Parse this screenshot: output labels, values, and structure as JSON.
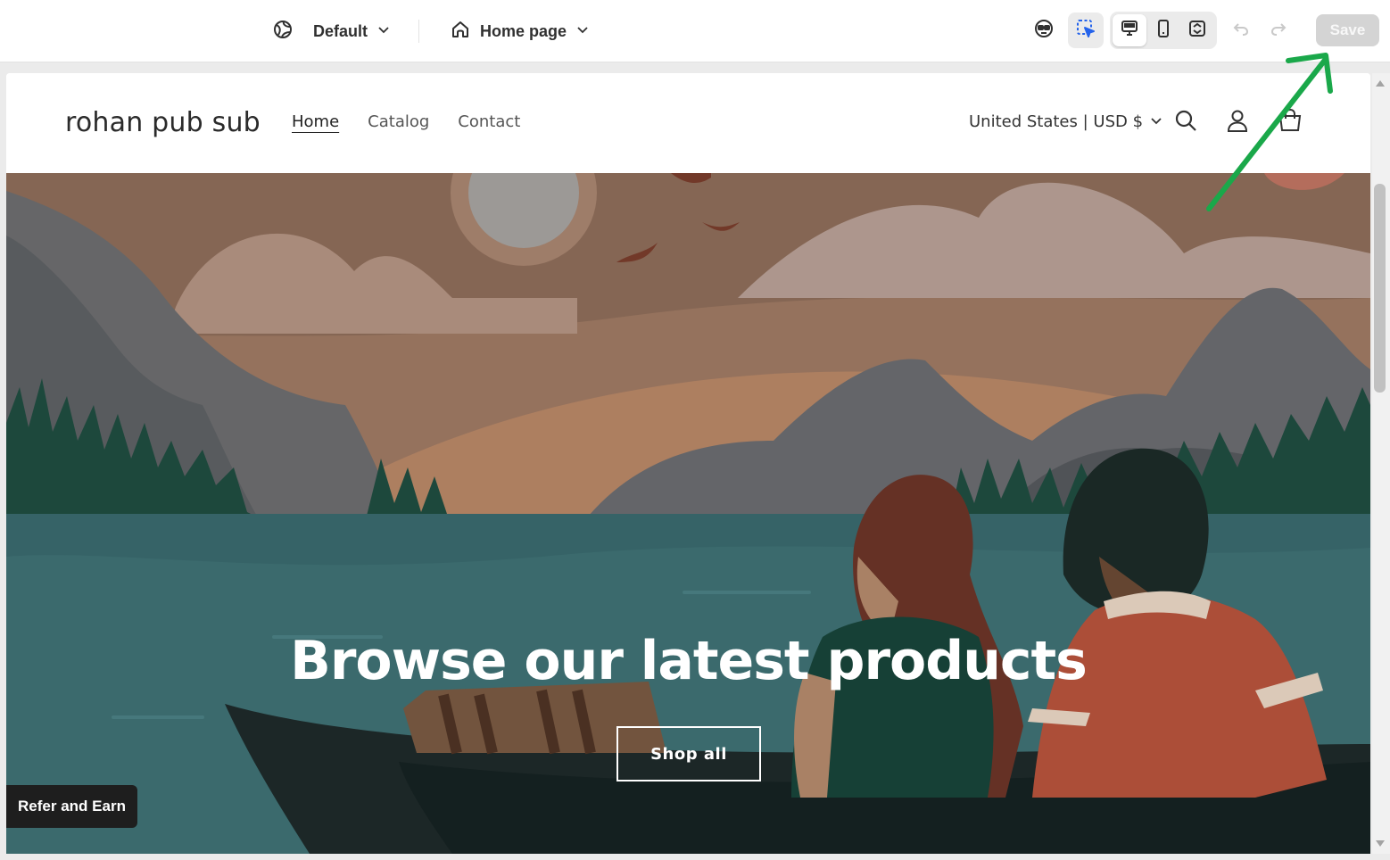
{
  "editor": {
    "theme_selector": {
      "label": "Default",
      "icon": "globe-icon"
    },
    "page_selector": {
      "label": "Home page",
      "icon": "home-icon"
    },
    "toolbar_icons": [
      "sidekick-icon",
      "inspector-icon",
      "desktop-icon",
      "mobile-icon",
      "fullscreen-icon",
      "undo-icon",
      "redo-icon"
    ],
    "active_view": "desktop",
    "save_label": "Save",
    "save_enabled": false
  },
  "store": {
    "brand": "rohan pub sub",
    "nav": [
      {
        "label": "Home",
        "active": true
      },
      {
        "label": "Catalog",
        "active": false
      },
      {
        "label": "Contact",
        "active": false
      }
    ],
    "currency": "United States | USD $",
    "header_icons": [
      "search-icon",
      "account-icon",
      "cart-icon"
    ]
  },
  "hero": {
    "title": "Browse our latest products",
    "button_label": "Shop all"
  },
  "floating": {
    "refer_label": "Refer and Earn"
  },
  "colors": {
    "annotation_arrow": "#1aa84a",
    "water": "#3d6f74",
    "sky": "#a67a62",
    "accent_text": "#ffffff"
  }
}
